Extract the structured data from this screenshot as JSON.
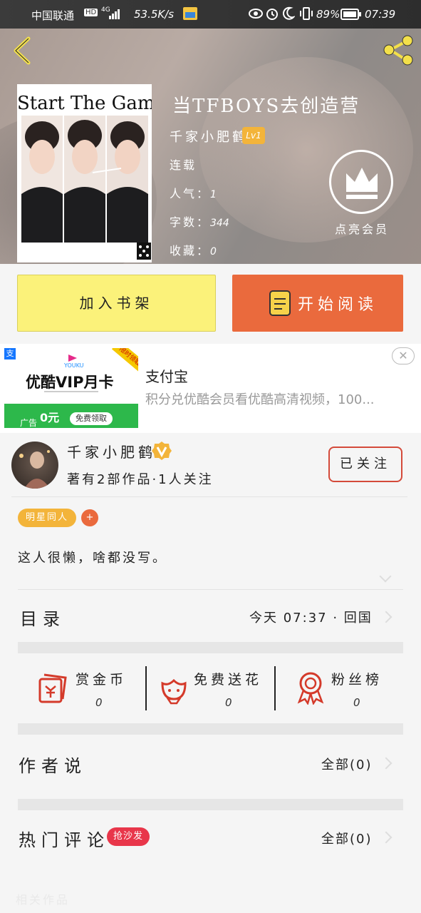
{
  "status_bar": {
    "carrier": "中国联通",
    "hd": "HD",
    "network": "4G",
    "speed": "53.5K/s",
    "battery_pct": "89%",
    "time": "07:39"
  },
  "book": {
    "title": "当TFBOYS去创造营",
    "author": "千家小肥鹤",
    "level": "Lv1",
    "status": "连载",
    "popularity_label": "人气：",
    "popularity": "1",
    "words_label": "字数：",
    "words": "344",
    "favorites_label": "收藏：",
    "favorites": "0",
    "cover_text": "Start The Game",
    "vip_label": "点亮会员"
  },
  "actions": {
    "add_shelf": "加入书架",
    "start_read": "开始阅读"
  },
  "ad": {
    "image_brand": "YOUKU",
    "image_title": "优酷VIP月卡",
    "image_tag": "免费领取",
    "image_price": "0元",
    "image_corner": "限时领取",
    "image_label": "广告",
    "title": "支付宝",
    "desc": "积分兑优酷会员看优酷高清视频，100...",
    "close": "✕"
  },
  "author_section": {
    "name": "千家小肥鹤",
    "works": "著有2部作品·1人关注",
    "follow_label": "已关注",
    "tag": "明星同人",
    "tag_add": "+",
    "bio": "这人很懒，啥都没写。"
  },
  "catalog": {
    "label": "目录",
    "update": "今天 07:37 · 回国"
  },
  "stats": [
    {
      "label": "赏金币",
      "value": "0",
      "icon": "red-envelope-icon"
    },
    {
      "label": "免费送花",
      "value": "0",
      "icon": "flower-icon"
    },
    {
      "label": "粉丝榜",
      "value": "0",
      "icon": "medal-icon"
    }
  ],
  "author_says": {
    "label": "作者说",
    "all": "全部(0)"
  },
  "hot_comments": {
    "label": "热门评论",
    "tag": "抢沙发",
    "all": "全部(0)"
  },
  "footer": {
    "watermark": "相关作品"
  },
  "colors": {
    "accent_orange": "#ea6a3d",
    "shelf_yellow": "#fbf27a",
    "badge_gold": "#f3b43a",
    "hot_red": "#e8364a"
  }
}
